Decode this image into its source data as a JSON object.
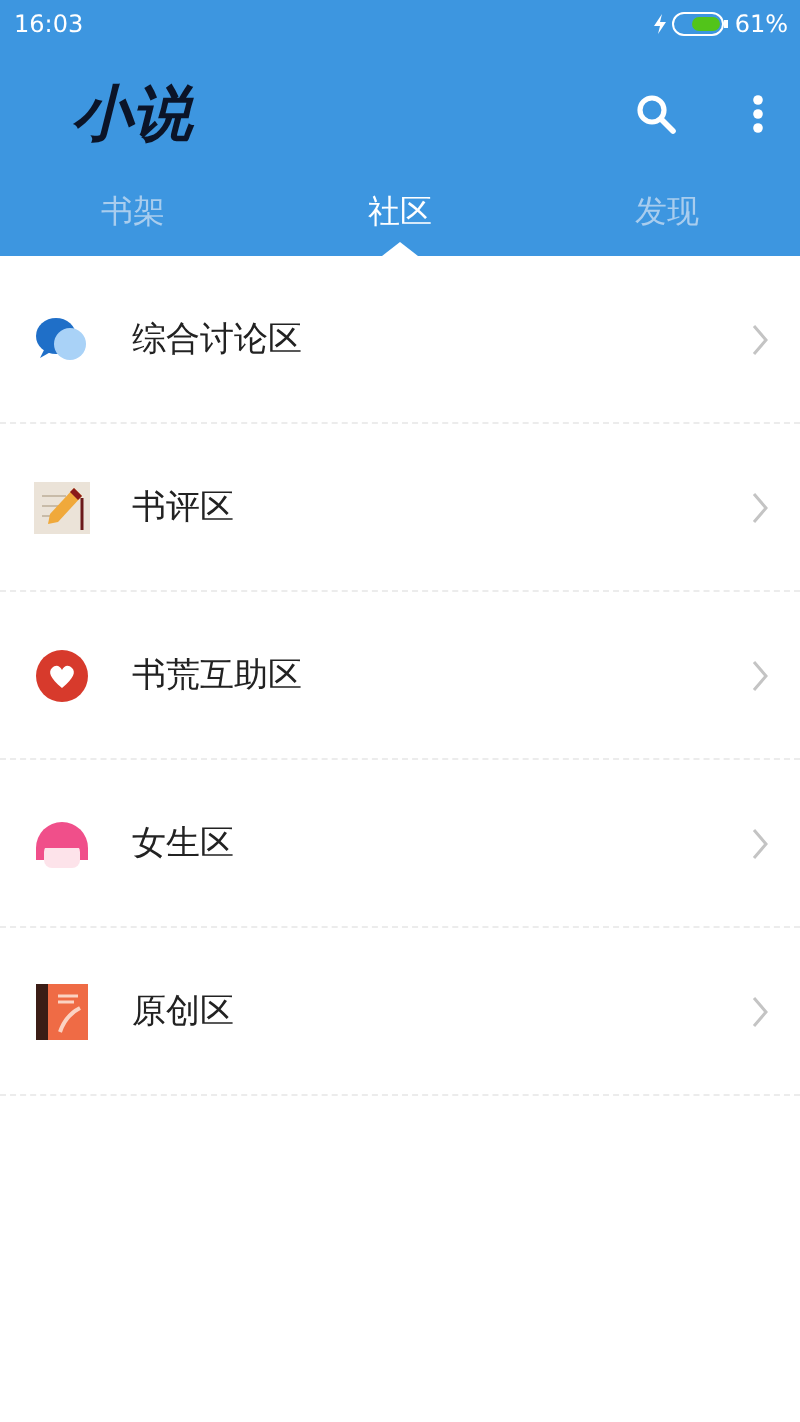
{
  "status_bar": {
    "time": "16:03",
    "battery": "61%"
  },
  "app_bar": {
    "title": "小说"
  },
  "tabs": [
    {
      "label": "书架",
      "selected": false
    },
    {
      "label": "社区",
      "selected": true
    },
    {
      "label": "发现",
      "selected": false
    }
  ],
  "sections": [
    {
      "label": "综合讨论区",
      "kind": "chat"
    },
    {
      "label": "书评区",
      "kind": "pencil"
    },
    {
      "label": "书荒互助区",
      "kind": "heart"
    },
    {
      "label": "女生区",
      "kind": "girl"
    },
    {
      "label": "原创区",
      "kind": "book"
    }
  ]
}
